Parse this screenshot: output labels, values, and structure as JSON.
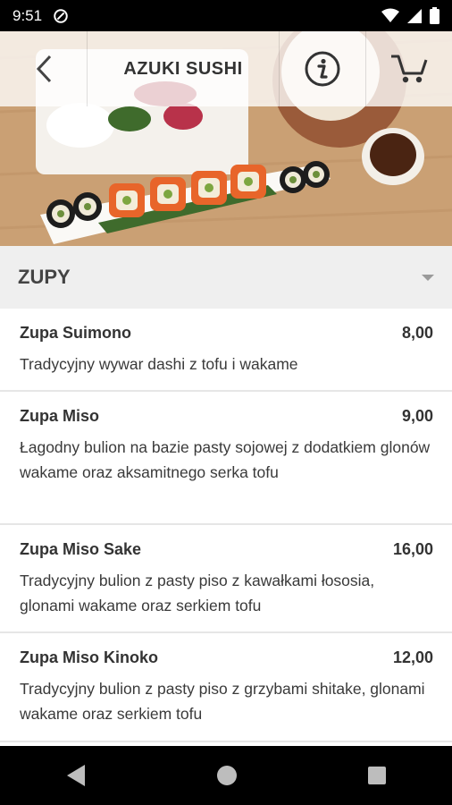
{
  "status_bar": {
    "time": "9:51"
  },
  "header": {
    "title": "AZUKI SUSHI"
  },
  "category": {
    "title": "ZUPY"
  },
  "menu": {
    "items": [
      {
        "name": "Zupa Suimono",
        "price": "8,00",
        "description": "Tradycyjny wywar dashi z tofu i wakame"
      },
      {
        "name": "Zupa Miso",
        "price": "9,00",
        "description": "Łagodny bulion na bazie pasty sojowej z dodatkiem glonów wakame oraz aksamitnego serka tofu"
      },
      {
        "name": "Zupa Miso Sake",
        "price": "16,00",
        "description": "Tradycyjny bulion z pasty piso z kawałkami łososia, glonami wakame oraz serkiem tofu"
      },
      {
        "name": "Zupa Miso Kinoko",
        "price": "12,00",
        "description": "Tradycyjny bulion z pasty piso z grzybami shitake, glonami wakame oraz serkiem tofu"
      }
    ]
  },
  "icons": {
    "back": "chevron-left-icon",
    "info": "info-icon",
    "cart": "cart-icon",
    "category_toggle": "dropdown-arrow-icon"
  }
}
